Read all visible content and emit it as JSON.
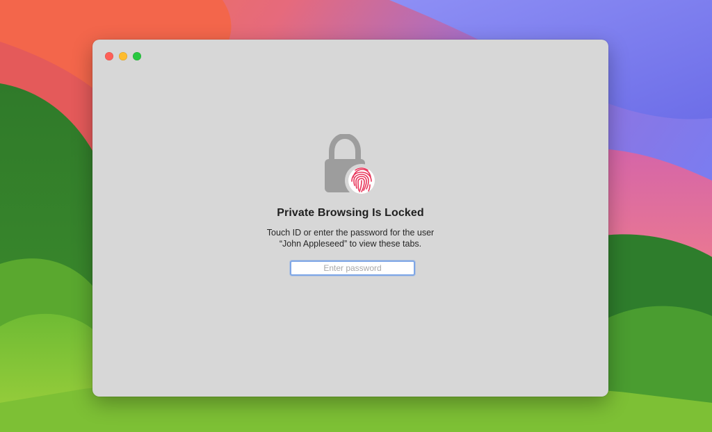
{
  "window": {
    "buttons": {
      "close": "close-window",
      "minimize": "minimize-window",
      "zoom": "zoom-window"
    }
  },
  "locked_view": {
    "icon": "lock-with-fingerprint",
    "title": "Private Browsing Is Locked",
    "message_line1": "Touch ID or enter the password for the user",
    "message_line2": "“John Appleseed” to view these tabs.",
    "password": {
      "value": "",
      "placeholder": "Enter password"
    }
  },
  "colors": {
    "window_background": "#d7d7d7",
    "lock_gray": "#9d9d9d",
    "fingerprint_red": "#e8365b",
    "focus_ring": "#7ea6e6",
    "traffic_close": "#fe5f57",
    "traffic_minimize": "#febc2e",
    "traffic_zoom": "#28c840"
  }
}
